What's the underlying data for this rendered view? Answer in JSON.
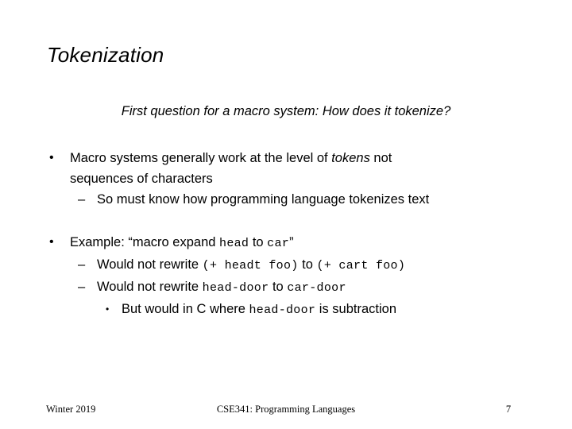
{
  "slide": {
    "title": "Tokenization",
    "subtitle": "First question for a macro system: How does it tokenize?",
    "background_color": "#ffffff",
    "text_color": "#000000"
  },
  "block_one": {
    "bullet_marker": "•",
    "line1_part1": "Macro systems generally work at the level of ",
    "line1_italic": "tokens",
    "line1_part2": " not",
    "line2": "sequences of characters",
    "sub_marker": "–",
    "sub_line": "So must know how programming language tokenizes text"
  },
  "block_two": {
    "bullet_marker": "•",
    "line1_part1": "Example: “macro expand ",
    "line1_code1": "head",
    "line1_part2": " to ",
    "line1_code2": "car",
    "line1_part3": "”",
    "sub_marker": "–",
    "sub1_part1": "Would not rewrite ",
    "sub1_code1": "(+ headt foo)",
    "sub1_part2": " to ",
    "sub1_code2": "(+ cart foo)",
    "sub2_part1": "Would not rewrite ",
    "sub2_code1": "head-door",
    "sub2_part2": " to ",
    "sub2_code2": "car-door",
    "sub_sub_marker": "•",
    "sub3_part1": "But would in C where ",
    "sub3_code1": "head-door",
    "sub3_part2": " is subtraction"
  },
  "footer": {
    "left": "Winter 2019",
    "center": "CSE341: Programming Languages",
    "page_number": "7"
  }
}
